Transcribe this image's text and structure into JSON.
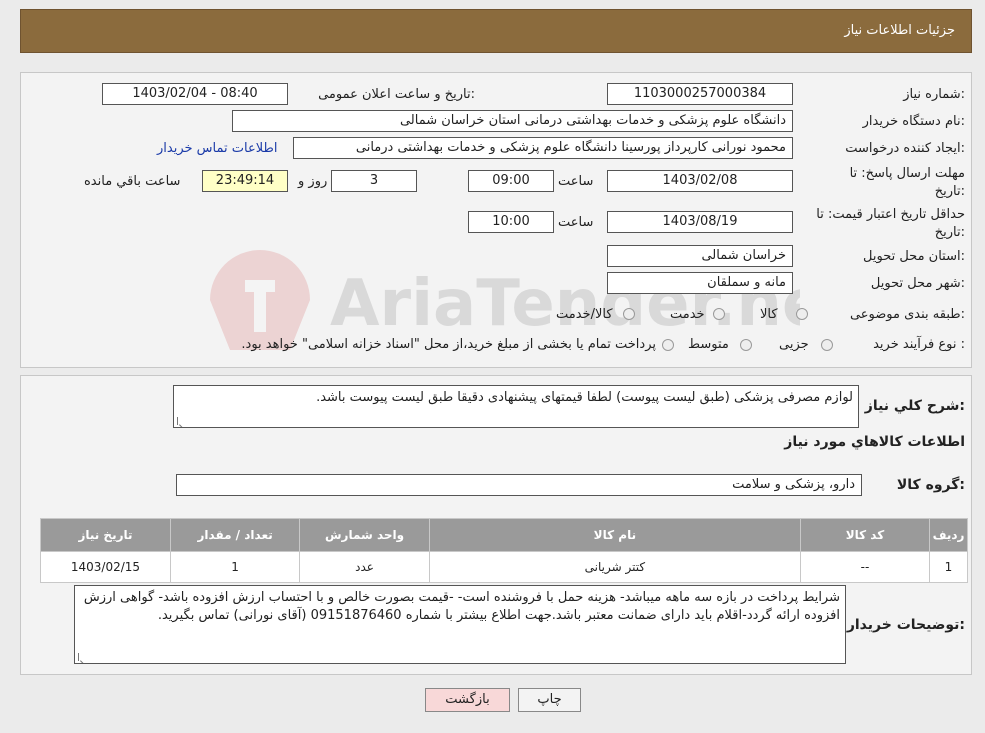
{
  "header": {
    "title": "جزئیات اطلاعات نیاز"
  },
  "details": {
    "need_number_label": "شماره نیاز:",
    "need_number": "1103000257000384",
    "announce_label": "تاریخ و ساعت اعلان عمومی:",
    "announce_value": "1403/02/04 - 08:40",
    "buyer_org_label": "نام دستگاه خریدار:",
    "buyer_org": "دانشگاه علوم پزشکی و خدمات بهداشتی درمانی استان خراسان شمالی",
    "creator_label": "ایجاد کننده درخواست:",
    "creator": "محمود نورانی کارپرداز پورسینا دانشگاه علوم پزشکی و خدمات بهداشتی درمانی",
    "contact_link": "اطلاعات تماس خریدار",
    "deadline_label_1": "مهلت ارسال پاسخ: تا",
    "deadline_label_2": "تاریخ:",
    "deadline_date": "1403/02/08",
    "time_label": "ساعت",
    "deadline_time": "09:00",
    "days": "3",
    "days_label": "روز و",
    "remaining": "23:49:14",
    "remaining_label": "ساعت باقي مانده",
    "validity_label_1": "حداقل تاریخ اعتبار قیمت: تا",
    "validity_label_2": "تاریخ:",
    "validity_date": "1403/08/19",
    "validity_time": "10:00",
    "province_label": "استان محل تحویل:",
    "province": "خراسان شمالی",
    "city_label": "شهر محل تحویل:",
    "city": "مانه و سملقان",
    "category_label": "طبقه بندی موضوعی:",
    "category_options": [
      "کالا",
      "خدمت",
      "کالا/خدمت"
    ],
    "process_label": "نوع فرآیند خرید :",
    "process_options": [
      "جزیی",
      "متوسط"
    ],
    "process_note": "پرداخت تمام یا بخشی از مبلغ خرید،از محل \"اسناد خزانه اسلامی\" خواهد بود."
  },
  "summary": {
    "label": "شرح کلي نياز:",
    "text": "لوازم مصرفی پزشکی (طبق لیست پیوست) لطفا قیمتهای پیشنهادی دقیقا طبق لیست پیوست باشد."
  },
  "goods": {
    "section_title": "اطلاعات کالاهاي مورد نياز",
    "group_label": "گروه کالا:",
    "group_value": "دارو، پزشکی و سلامت",
    "columns": [
      "ردیف",
      "کد کالا",
      "نام کالا",
      "واحد شمارش",
      "تعداد / مقدار",
      "تاریخ نیاز"
    ],
    "rows": [
      [
        "1",
        "--",
        "کتتر شریانی",
        "عدد",
        "1",
        "1403/02/15"
      ]
    ]
  },
  "buyer_notes": {
    "label": "توضیحات خریدار:",
    "text": "شرایط پرداخت در بازه سه ماهه میباشد- هزینه حمل با فروشنده است- -قیمت بصورت خالص و با احتساب ارزش افزوده باشد- گواهی ارزش افزوده ارائه گردد-اقلام باید دارای ضمانت معتبر باشد.جهت اطلاع بیشتر با شماره 09151876460 (آقای نورانی) تماس بگیرید."
  },
  "buttons": {
    "print": "چاپ",
    "back": "بازگشت"
  },
  "watermark": {
    "text": "AriaTender.neT"
  },
  "colors": {
    "header": "#8b6b3d",
    "link": "#1a3aa8",
    "back_button": "#f8d8d8",
    "remaining_bg": "#ffffc6"
  },
  "icons": {
    "watermark_logo": "ariatender-logo-icon",
    "resize_grip": "resize-grip-icon"
  }
}
